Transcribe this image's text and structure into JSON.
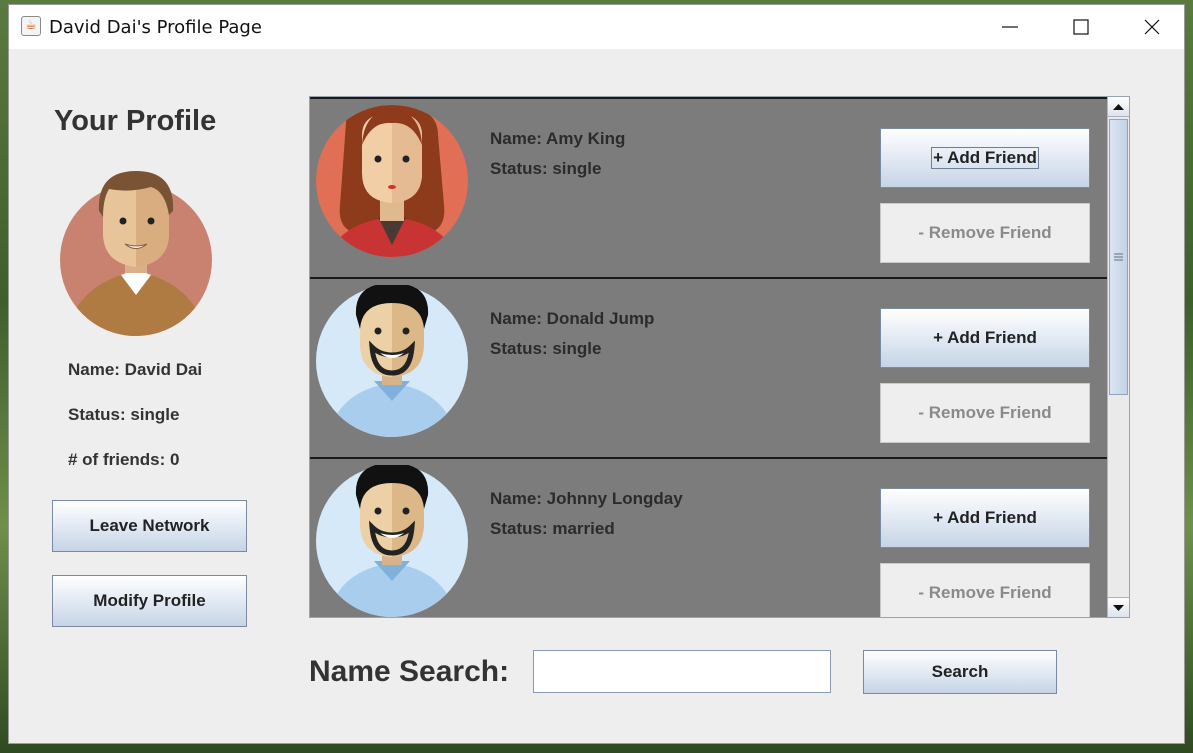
{
  "window": {
    "title": "David Dai's Profile Page",
    "app_icon": "java-cup-icon",
    "controls": [
      "minimize-icon",
      "maximize-icon",
      "close-icon"
    ]
  },
  "profile": {
    "heading": "Your Profile",
    "name_line": "Name: David Dai",
    "status_line": "Status: single",
    "friends_line": "# of friends: 0",
    "leave_label": "Leave Network",
    "modify_label": "Modify Profile"
  },
  "people": [
    {
      "name_line": "Name: Amy King",
      "status_line": "Status: single",
      "add_label": "+ Add Friend",
      "remove_label": "- Remove Friend",
      "avatar": "woman-red-hair-avatar"
    },
    {
      "name_line": "Name: Donald Jump",
      "status_line": "Status: single",
      "add_label": "+ Add Friend",
      "remove_label": "- Remove Friend",
      "avatar": "man-beard-avatar"
    },
    {
      "name_line": "Name: Johnny Longday",
      "status_line": "Status: married",
      "add_label": "+ Add Friend",
      "remove_label": "- Remove Friend",
      "avatar": "man-beard-avatar"
    }
  ],
  "search": {
    "label": "Name Search:",
    "value": "",
    "button_label": "Search"
  }
}
